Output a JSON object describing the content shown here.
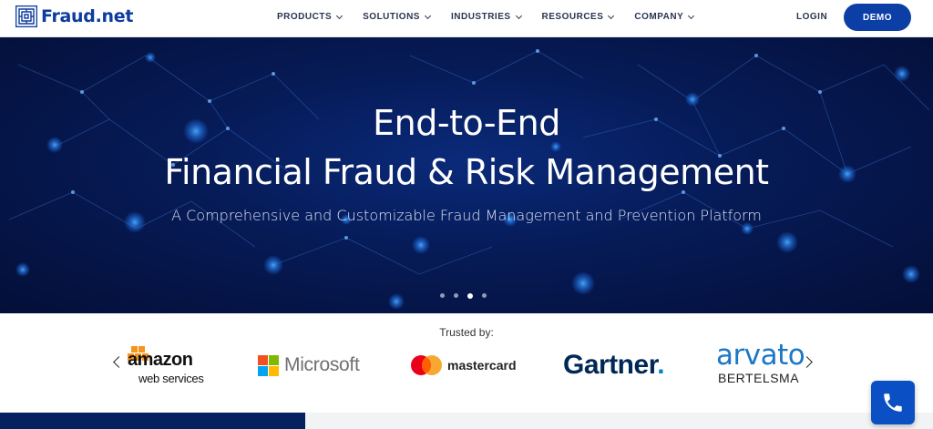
{
  "brand": {
    "name": "Fraud.net"
  },
  "nav": {
    "items": [
      {
        "label": "PRODUCTS"
      },
      {
        "label": "SOLUTIONS"
      },
      {
        "label": "INDUSTRIES"
      },
      {
        "label": "RESOURCES"
      },
      {
        "label": "COMPANY"
      }
    ],
    "login_label": "LOGIN",
    "demo_label": "DEMO"
  },
  "hero": {
    "title_line1": "End-to-End",
    "title_line2": "Financial Fraud & Risk Management",
    "subtitle": "A Comprehensive and Customizable Fraud Management and Prevention Platform",
    "slide_count": 4,
    "active_slide": 3
  },
  "trusted": {
    "label": "Trusted by:",
    "logos": {
      "amazon_top": "amazon",
      "amazon_bottom": "web services",
      "microsoft": "Microsoft",
      "mastercard": "mastercard",
      "gartner": "Gartner",
      "gartner_dot": ".",
      "arvato_top": "arvato",
      "arvato_bottom": "BERTELSMA"
    }
  },
  "colors": {
    "brand_blue": "#0b3fa6",
    "hero_bg": "#061a55",
    "phone_button": "#0b4fc4"
  },
  "icons": {
    "phone": "phone-icon",
    "prev": "chevron-left-icon",
    "next": "chevron-right-icon"
  }
}
